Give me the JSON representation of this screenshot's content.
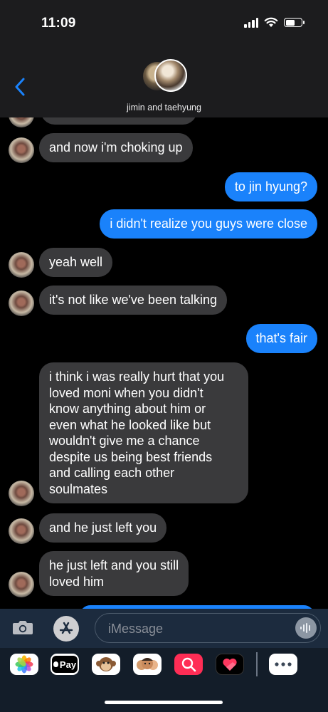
{
  "status_bar": {
    "time": "11:09"
  },
  "header": {
    "contact_name": "jimin and taehyung"
  },
  "messages": [
    {
      "dir": "in",
      "text": "and now i'm choking up"
    },
    {
      "dir": "out",
      "text": "to jin hyung?"
    },
    {
      "dir": "out",
      "text": "i didn't realize you guys were close"
    },
    {
      "dir": "in",
      "text": "yeah well"
    },
    {
      "dir": "in",
      "text": "it's not like we've been talking"
    },
    {
      "dir": "out",
      "text": "that's fair"
    },
    {
      "dir": "in",
      "lines": [
        "i think i was really hurt that you",
        "loved moni when you didn't",
        "know anything about him or",
        "even what he looked like but",
        "wouldn't give me a chance",
        "despite us being best friends",
        "and calling each other",
        "soulmates"
      ]
    },
    {
      "dir": "in",
      "text": "and he just left you"
    },
    {
      "dir": "in",
      "lines": [
        "he just left and you still",
        "loved him"
      ]
    }
  ],
  "composer": {
    "placeholder": "iMessage"
  },
  "app_drawer": {
    "items": [
      "photos-app",
      "apple-pay",
      "animoji",
      "memoji",
      "search-images",
      "heart-stickers",
      "more-apps"
    ],
    "apple_pay_label": "Pay"
  }
}
